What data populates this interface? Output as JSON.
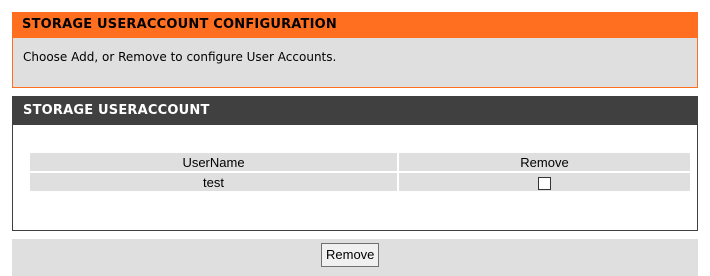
{
  "config_section": {
    "title": "STORAGE USERACCOUNT CONFIGURATION",
    "description": "Choose Add, or Remove to configure User Accounts."
  },
  "account_section": {
    "title": "STORAGE USERACCOUNT",
    "table": {
      "columns": [
        "UserName",
        "Remove"
      ],
      "rows": [
        {
          "username": "test",
          "remove_checked": false
        }
      ]
    }
  },
  "footer": {
    "remove_button_label": "Remove"
  },
  "colors": {
    "orange_accent": "#ff6f1f",
    "dark_header": "#404040",
    "panel_gray": "#dfdfdf"
  }
}
